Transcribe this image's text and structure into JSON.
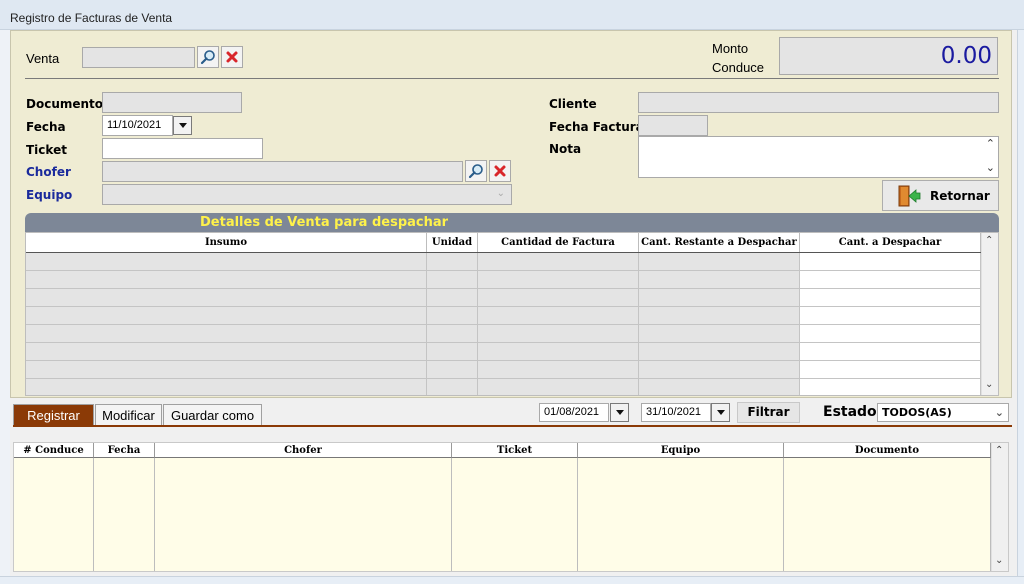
{
  "window": {
    "title": "Registro de Facturas de Venta"
  },
  "header": {
    "venta_label": "Venta",
    "venta_value": "",
    "monto_label_1": "Monto",
    "monto_label_2": "Conduce",
    "monto_value": "0.00"
  },
  "form": {
    "documento_label": "Documento",
    "fecha_label": "Fecha",
    "fecha_value": "11/10/2021",
    "ticket_label": "Ticket",
    "chofer_label": "Chofer",
    "equipo_label": "Equipo",
    "cliente_label": "Cliente",
    "fecha_factura_label": "Fecha Factura",
    "nota_label": "Nota",
    "retornar_label": "Retornar"
  },
  "details": {
    "title": "Detalles de Venta para despachar",
    "columns": [
      "Insumo",
      "Unidad",
      "Cantidad de Factura",
      "Cant. Restante a Despachar",
      "Cant. a Despachar"
    ],
    "row_count": 8
  },
  "tabs": [
    "Registrar",
    "Modificar",
    "Guardar como"
  ],
  "filters": {
    "date_from": "01/08/2021",
    "date_to": "31/10/2021",
    "filtrar_label": "Filtrar",
    "estado_label": "Estado",
    "estado_value": "TODOS(AS)"
  },
  "list": {
    "columns": [
      "# Conduce",
      "Fecha",
      "Chofer",
      "Ticket",
      "Equipo",
      "Documento"
    ]
  },
  "colors": {
    "panel_bg": "#efecd3",
    "accent_tab": "#8b3a06",
    "monto_text": "#1a1aa0",
    "details_title": "#fff24a",
    "list_bg": "#fffde8"
  }
}
